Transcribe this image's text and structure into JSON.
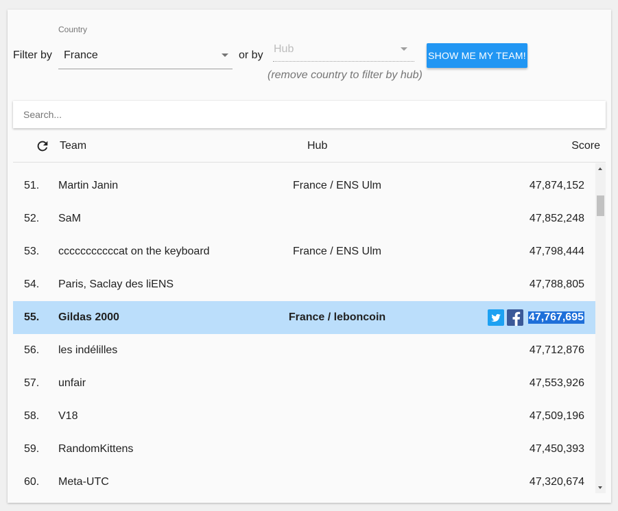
{
  "filters": {
    "filter_by_label": "Filter by",
    "country_label": "Country",
    "country_value": "France",
    "or_by_label": "or by",
    "hub_placeholder": "Hub",
    "hub_hint": "(remove country to filter by hub)",
    "show_team_button": "SHOW ME MY TEAM!"
  },
  "search": {
    "placeholder": "Search..."
  },
  "table": {
    "headers": {
      "team": "Team",
      "hub": "Hub",
      "score": "Score"
    },
    "rows": [
      {
        "rank": "51.",
        "team": "Martin Janin",
        "hub": "France / ENS Ulm",
        "score": "47,874,152"
      },
      {
        "rank": "52.",
        "team": "SaM",
        "hub": "",
        "score": "47,852,248"
      },
      {
        "rank": "53.",
        "team": "cccccccccccat on the keyboard",
        "hub": "France / ENS Ulm",
        "score": "47,798,444"
      },
      {
        "rank": "54.",
        "team": "Paris, Saclay des liENS",
        "hub": "",
        "score": "47,788,805"
      },
      {
        "rank": "55.",
        "team": "Gildas 2000",
        "hub": "France / leboncoin",
        "score": "47,767,695",
        "highlight": true
      },
      {
        "rank": "56.",
        "team": "les indélilles",
        "hub": "",
        "score": "47,712,876"
      },
      {
        "rank": "57.",
        "team": "unfair",
        "hub": "",
        "score": "47,553,926"
      },
      {
        "rank": "58.",
        "team": "V18",
        "hub": "",
        "score": "47,509,196"
      },
      {
        "rank": "59.",
        "team": "RandomKittens",
        "hub": "",
        "score": "47,450,393"
      },
      {
        "rank": "60.",
        "team": "Meta-UTC",
        "hub": "",
        "score": "47,320,674"
      }
    ]
  },
  "icons": {
    "refresh": "refresh-icon",
    "twitter": "twitter-icon",
    "facebook": "facebook-icon"
  },
  "colors": {
    "accent": "#2196f3",
    "highlight_row": "#bbdefb",
    "twitter": "#1da1f2",
    "facebook": "#3b5998",
    "selection": "#1e6fd9"
  }
}
